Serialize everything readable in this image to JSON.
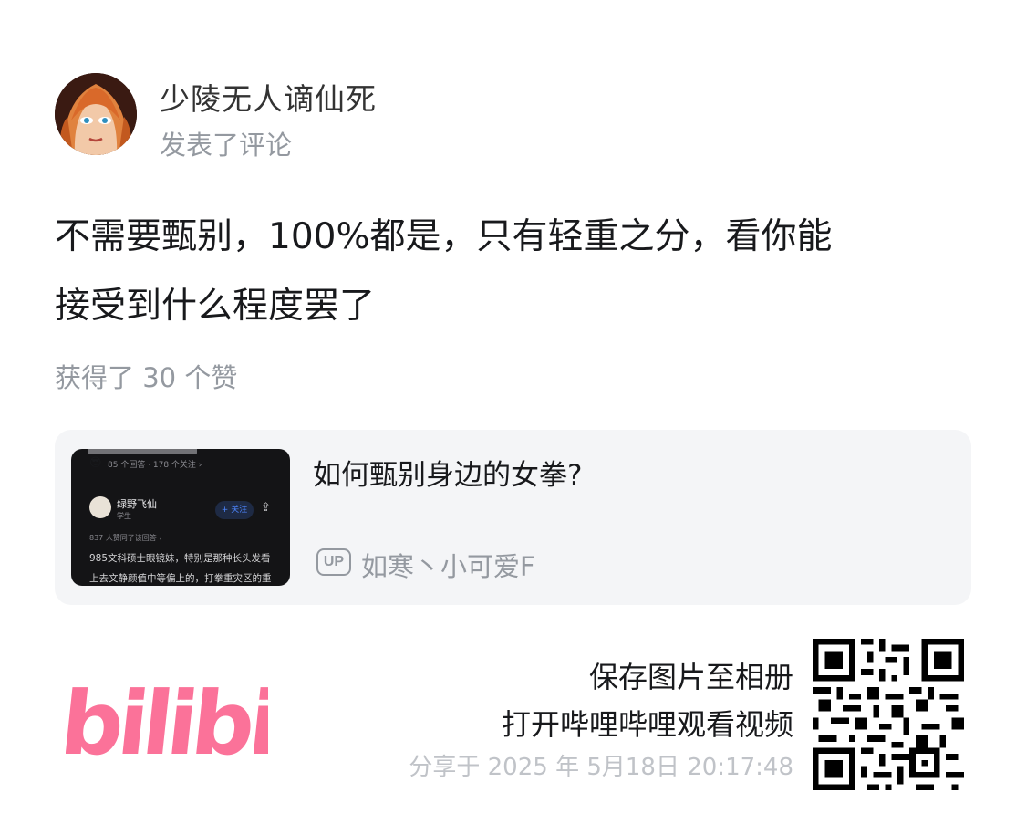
{
  "post": {
    "username": "少陵无人谪仙死",
    "action": "发表了评论",
    "comment_line1": "不需要甄别，100%都是，只有轻重之分，看你能",
    "comment_line2": "接受到什么程度罢了",
    "likes": "获得了 30 个赞"
  },
  "card": {
    "title": "如何甄别身边的女拳?",
    "up_badge": "UP",
    "uploader": "如寒丶小可爱F",
    "thumbnail": {
      "meta": "85 个回答 · 178 个关注 ›",
      "author": "绿野飞仙",
      "role": "学生",
      "follow": "+ 关注",
      "voted": "837 人赞同了该回答 ›",
      "line1": "985文科硕士眼镜妹，特别是那种长头发看",
      "line2": "上去文静颜值中等偏上的，打拳重灾区的重"
    }
  },
  "footer": {
    "logo_text": "bilibili",
    "save_text": "保存图片至相册",
    "open_text": "打开哔哩哔哩观看视频",
    "share_date": "分享于 2025 年 5月18日 20:17:48"
  },
  "colors": {
    "brand_pink": "#fb7299",
    "secondary_text": "#9499a0",
    "card_bg": "#f4f5f7"
  },
  "icons": {
    "avatar": "anime-girl-avatar",
    "up": "up-badge-icon",
    "qr": "qr-code-icon"
  }
}
